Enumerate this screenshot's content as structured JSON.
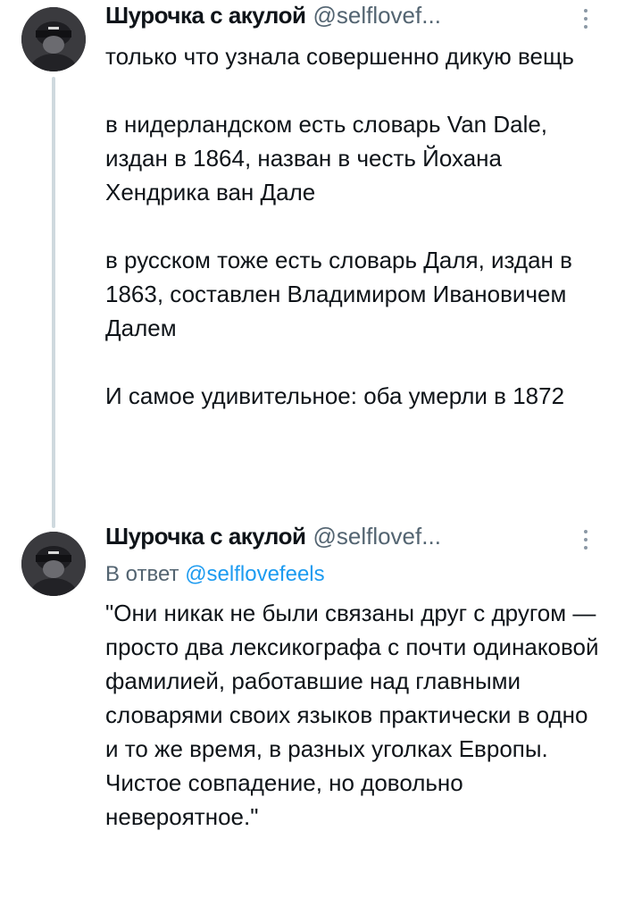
{
  "tweets": [
    {
      "author": {
        "display_name": "Шурочка с акулой",
        "handle": "@selflovef..."
      },
      "paragraphs": [
        "только что узнала совершенно дикую вещь",
        "в нидерландском есть словарь Van Dale, издан в 1864, назван в честь Йохана Хендрика ван Дале",
        "в русском тоже есть словарь Даля, издан в 1863, составлен Владимиром Ивановичем Далем",
        "И самое удивительное: оба умерли в 1872"
      ]
    },
    {
      "author": {
        "display_name": "Шурочка с акулой",
        "handle": "@selflovef..."
      },
      "reply_to": {
        "prefix": "В ответ",
        "mention": "@selflovefeels"
      },
      "text": "\"Они никак не были связаны друг с другом — просто два лексикографа с почти одинаковой фамилией, работавшие над главными словарями своих языков практически в одно и то же время, в разных уголках Европы. Чистое совпадение, но довольно невероятное.\""
    }
  ],
  "icons": {
    "more": "more-vertical-icon",
    "avatar": "avatar-image"
  },
  "colors": {
    "text": "#0f1419",
    "secondary": "#536471",
    "link": "#1d9bf0",
    "thread_line": "#cfd9de"
  }
}
